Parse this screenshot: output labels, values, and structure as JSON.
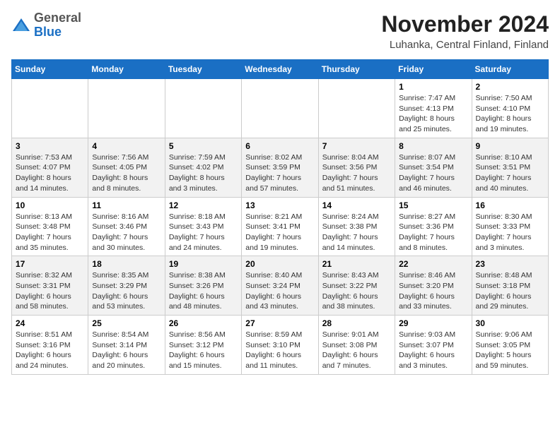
{
  "header": {
    "logo": {
      "general": "General",
      "blue": "Blue"
    },
    "title": "November 2024",
    "subtitle": "Luhanka, Central Finland, Finland"
  },
  "calendar": {
    "weekdays": [
      "Sunday",
      "Monday",
      "Tuesday",
      "Wednesday",
      "Thursday",
      "Friday",
      "Saturday"
    ],
    "rows": [
      {
        "cells": [
          {
            "day": "",
            "info": ""
          },
          {
            "day": "",
            "info": ""
          },
          {
            "day": "",
            "info": ""
          },
          {
            "day": "",
            "info": ""
          },
          {
            "day": "",
            "info": ""
          },
          {
            "day": "1",
            "info": "Sunrise: 7:47 AM\nSunset: 4:13 PM\nDaylight: 8 hours and 25 minutes."
          },
          {
            "day": "2",
            "info": "Sunrise: 7:50 AM\nSunset: 4:10 PM\nDaylight: 8 hours and 19 minutes."
          }
        ]
      },
      {
        "cells": [
          {
            "day": "3",
            "info": "Sunrise: 7:53 AM\nSunset: 4:07 PM\nDaylight: 8 hours and 14 minutes."
          },
          {
            "day": "4",
            "info": "Sunrise: 7:56 AM\nSunset: 4:05 PM\nDaylight: 8 hours and 8 minutes."
          },
          {
            "day": "5",
            "info": "Sunrise: 7:59 AM\nSunset: 4:02 PM\nDaylight: 8 hours and 3 minutes."
          },
          {
            "day": "6",
            "info": "Sunrise: 8:02 AM\nSunset: 3:59 PM\nDaylight: 7 hours and 57 minutes."
          },
          {
            "day": "7",
            "info": "Sunrise: 8:04 AM\nSunset: 3:56 PM\nDaylight: 7 hours and 51 minutes."
          },
          {
            "day": "8",
            "info": "Sunrise: 8:07 AM\nSunset: 3:54 PM\nDaylight: 7 hours and 46 minutes."
          },
          {
            "day": "9",
            "info": "Sunrise: 8:10 AM\nSunset: 3:51 PM\nDaylight: 7 hours and 40 minutes."
          }
        ]
      },
      {
        "cells": [
          {
            "day": "10",
            "info": "Sunrise: 8:13 AM\nSunset: 3:48 PM\nDaylight: 7 hours and 35 minutes."
          },
          {
            "day": "11",
            "info": "Sunrise: 8:16 AM\nSunset: 3:46 PM\nDaylight: 7 hours and 30 minutes."
          },
          {
            "day": "12",
            "info": "Sunrise: 8:18 AM\nSunset: 3:43 PM\nDaylight: 7 hours and 24 minutes."
          },
          {
            "day": "13",
            "info": "Sunrise: 8:21 AM\nSunset: 3:41 PM\nDaylight: 7 hours and 19 minutes."
          },
          {
            "day": "14",
            "info": "Sunrise: 8:24 AM\nSunset: 3:38 PM\nDaylight: 7 hours and 14 minutes."
          },
          {
            "day": "15",
            "info": "Sunrise: 8:27 AM\nSunset: 3:36 PM\nDaylight: 7 hours and 8 minutes."
          },
          {
            "day": "16",
            "info": "Sunrise: 8:30 AM\nSunset: 3:33 PM\nDaylight: 7 hours and 3 minutes."
          }
        ]
      },
      {
        "cells": [
          {
            "day": "17",
            "info": "Sunrise: 8:32 AM\nSunset: 3:31 PM\nDaylight: 6 hours and 58 minutes."
          },
          {
            "day": "18",
            "info": "Sunrise: 8:35 AM\nSunset: 3:29 PM\nDaylight: 6 hours and 53 minutes."
          },
          {
            "day": "19",
            "info": "Sunrise: 8:38 AM\nSunset: 3:26 PM\nDaylight: 6 hours and 48 minutes."
          },
          {
            "day": "20",
            "info": "Sunrise: 8:40 AM\nSunset: 3:24 PM\nDaylight: 6 hours and 43 minutes."
          },
          {
            "day": "21",
            "info": "Sunrise: 8:43 AM\nSunset: 3:22 PM\nDaylight: 6 hours and 38 minutes."
          },
          {
            "day": "22",
            "info": "Sunrise: 8:46 AM\nSunset: 3:20 PM\nDaylight: 6 hours and 33 minutes."
          },
          {
            "day": "23",
            "info": "Sunrise: 8:48 AM\nSunset: 3:18 PM\nDaylight: 6 hours and 29 minutes."
          }
        ]
      },
      {
        "cells": [
          {
            "day": "24",
            "info": "Sunrise: 8:51 AM\nSunset: 3:16 PM\nDaylight: 6 hours and 24 minutes."
          },
          {
            "day": "25",
            "info": "Sunrise: 8:54 AM\nSunset: 3:14 PM\nDaylight: 6 hours and 20 minutes."
          },
          {
            "day": "26",
            "info": "Sunrise: 8:56 AM\nSunset: 3:12 PM\nDaylight: 6 hours and 15 minutes."
          },
          {
            "day": "27",
            "info": "Sunrise: 8:59 AM\nSunset: 3:10 PM\nDaylight: 6 hours and 11 minutes."
          },
          {
            "day": "28",
            "info": "Sunrise: 9:01 AM\nSunset: 3:08 PM\nDaylight: 6 hours and 7 minutes."
          },
          {
            "day": "29",
            "info": "Sunrise: 9:03 AM\nSunset: 3:07 PM\nDaylight: 6 hours and 3 minutes."
          },
          {
            "day": "30",
            "info": "Sunrise: 9:06 AM\nSunset: 3:05 PM\nDaylight: 5 hours and 59 minutes."
          }
        ]
      }
    ]
  }
}
